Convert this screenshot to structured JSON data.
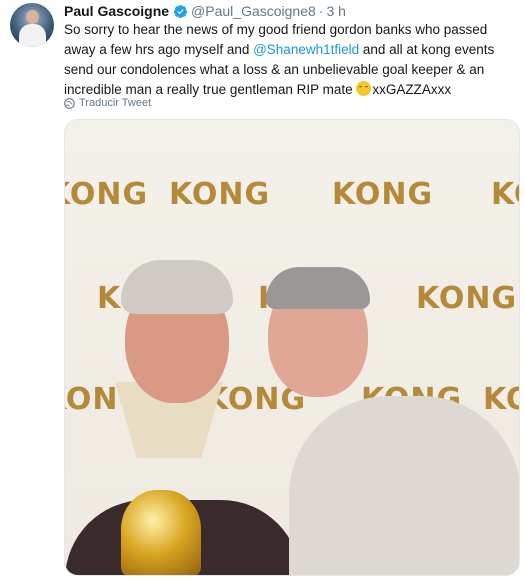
{
  "tweet": {
    "author_name": "Paul Gascoigne",
    "handle": "@Paul_Gascoigne8",
    "separator": "·",
    "time": "3 h",
    "text_part1": "So sorry to hear the news of my good friend gordon banks who passed away a few hrs ago myself and ",
    "mention": "@Shanewh1tfield",
    "text_part2": " and all at kong events send our condolences what a loss & an unbelievable goal keeper & an incredible man a really true gentleman RIP mate ",
    "text_part3": "xxGAZZAxxx",
    "translate_label": "Traducir Tweet"
  },
  "media": {
    "backdrop_word": "KONG",
    "brand_color": "#b4893a"
  },
  "colors": {
    "link": "#1b95e0",
    "muted": "#657786",
    "verified": "#1da1f2"
  }
}
